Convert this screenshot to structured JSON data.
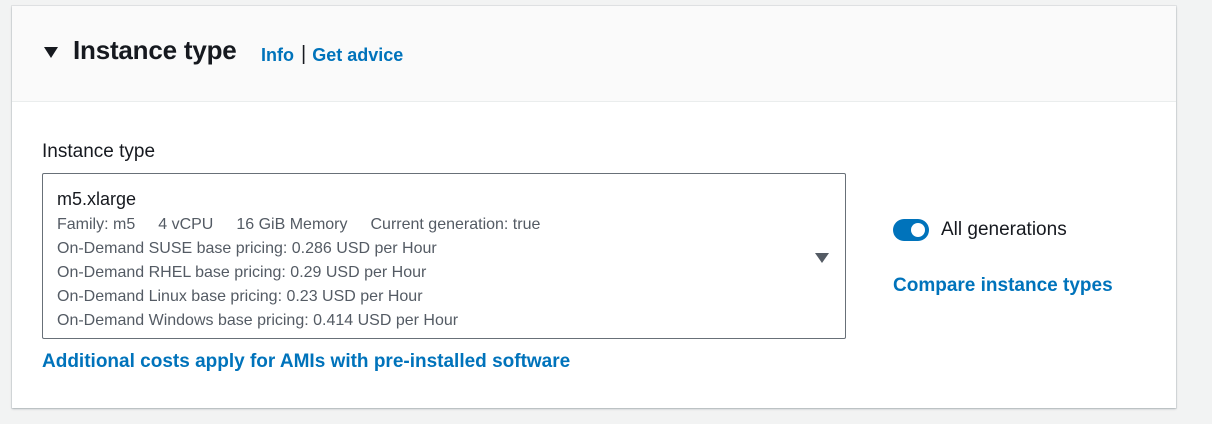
{
  "header": {
    "title": "Instance type",
    "info_link": "Info",
    "separator": "|",
    "advice_link": "Get advice",
    "collapse_icon": "triangle-down-icon"
  },
  "field": {
    "label": "Instance type",
    "selected_value": "m5.xlarge",
    "tags": {
      "family": "Family: m5",
      "vcpu": "4 vCPU",
      "memory": "16 GiB Memory",
      "generation": "Current generation: true"
    },
    "pricing": {
      "suse": "On-Demand SUSE base pricing: 0.286 USD per Hour",
      "rhel": "On-Demand RHEL base pricing: 0.29 USD per Hour",
      "linux": "On-Demand Linux base pricing: 0.23 USD per Hour",
      "windows": "On-Demand Windows base pricing: 0.414 USD per Hour"
    },
    "dropdown_icon": "caret-down-icon",
    "footer_link": "Additional costs apply for AMIs with pre-installed software"
  },
  "side": {
    "toggle_label": "All generations",
    "toggle_on": true,
    "compare_link": "Compare instance types"
  },
  "colors": {
    "link": "#0073bb",
    "toggle_on": "#0073bb",
    "text": "#16191f",
    "secondary_text": "#545b64",
    "header_bg": "#fafafa",
    "page_bg": "#f2f3f3"
  }
}
